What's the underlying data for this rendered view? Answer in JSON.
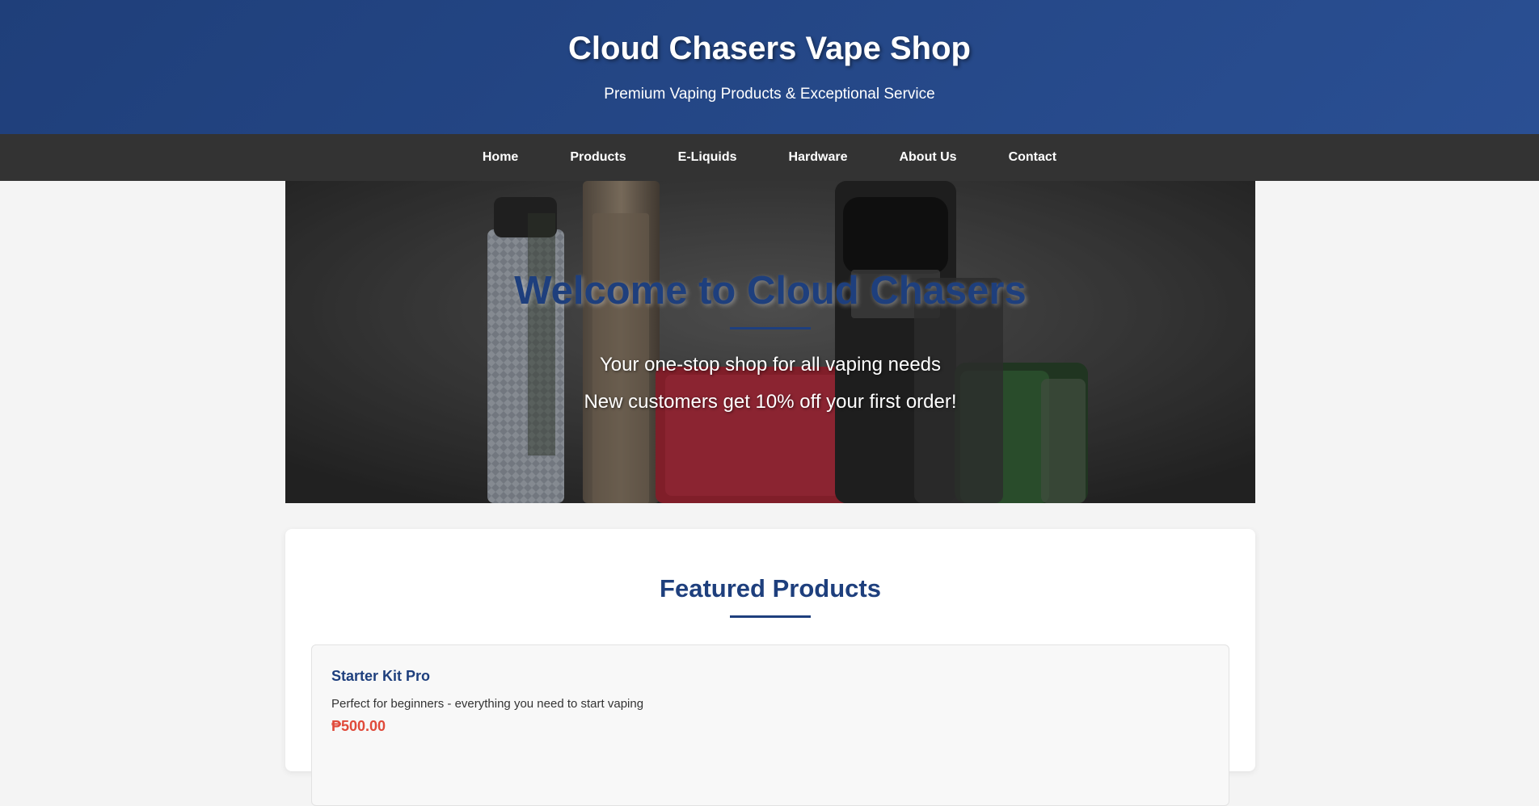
{
  "header": {
    "title": "Cloud Chasers Vape Shop",
    "subtitle": "Premium Vaping Products & Exceptional Service"
  },
  "nav": {
    "items": [
      {
        "label": "Home"
      },
      {
        "label": "Products"
      },
      {
        "label": "E-Liquids"
      },
      {
        "label": "Hardware"
      },
      {
        "label": "About Us"
      },
      {
        "label": "Contact"
      }
    ]
  },
  "hero": {
    "title": "Welcome to Cloud Chasers",
    "line1": "Your one-stop shop for all vaping needs",
    "line2": "New customers get 10% off your first order!"
  },
  "featured": {
    "title": "Featured Products",
    "products": [
      {
        "name": "Starter Kit Pro",
        "description": "Perfect for beginners - everything you need to start vaping",
        "price": "₱500.00"
      }
    ]
  },
  "colors": {
    "header_start": "#1f3f7a",
    "header_end": "#2a4f93",
    "nav_bg": "#333333",
    "accent": "#1e3f7d",
    "price": "#e04a3a"
  }
}
